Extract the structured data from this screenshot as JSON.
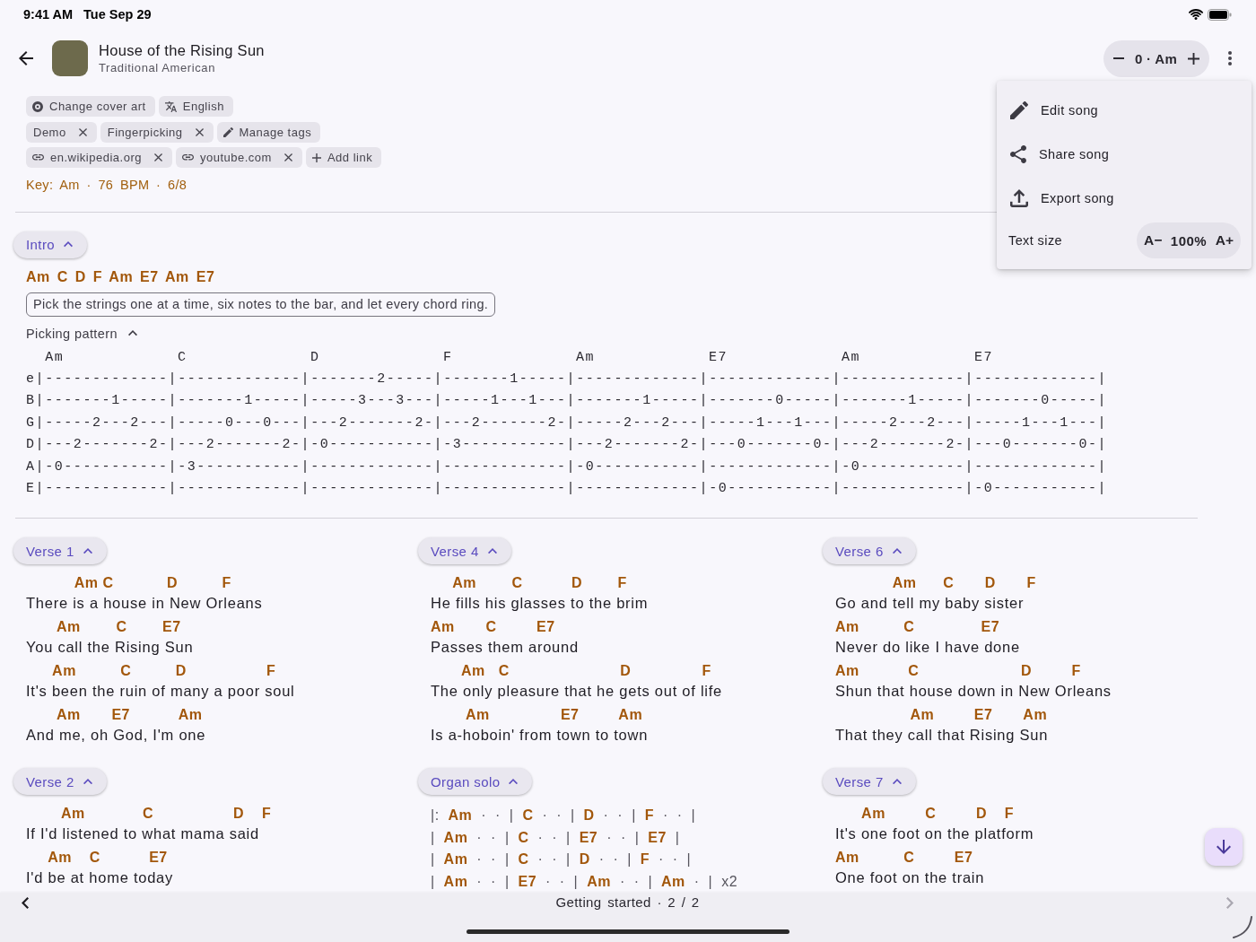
{
  "status": {
    "time": "9:41 AM",
    "date": "Tue Sep 29"
  },
  "song": {
    "title": "House of the Rising Sun",
    "artist": "Traditional American"
  },
  "transpose": {
    "value": "0 · Am"
  },
  "chip_rows": [
    [
      {
        "kind": "cover",
        "label": "Change cover art"
      },
      {
        "kind": "language",
        "label": "English"
      }
    ],
    [
      {
        "kind": "tag",
        "label": "Demo"
      },
      {
        "kind": "tag",
        "label": "Fingerpicking"
      },
      {
        "kind": "manage",
        "label": "Manage tags"
      }
    ],
    [
      {
        "kind": "link",
        "label": "en.wikipedia.org"
      },
      {
        "kind": "link",
        "label": "youtube.com"
      },
      {
        "kind": "add",
        "label": "Add link"
      }
    ]
  ],
  "meta": "Key: Am · 76 BPM · 6/8",
  "intro": {
    "name": "Intro",
    "expanded": true,
    "chords": "Am C D F Am E7 Am E7",
    "note": "Pick the strings one at a time, six notes to the bar, and let every chord ring.",
    "pattern": {
      "label": "Picking pattern",
      "expanded": true,
      "chords": [
        "Am",
        "C",
        "D",
        "F",
        "Am",
        "E7",
        "Am",
        "E7"
      ],
      "strings": [
        "e|-------------|-------------|-------2-----|-------1-----|-------------|-------------|-------------|-------------|",
        "B|-------1-----|-------1-----|-----3---3---|-----1---1---|-------1-----|-------0-----|-------1-----|-------0-----|",
        "G|-----2---2---|-----0---0---|---2-------2-|---2-------2-|-----2---2---|-----1---1---|-----2---2---|-----1---1---|",
        "D|---2-------2-|---2-------2-|-0-----------|-3-----------|---2-------2-|---0-------0-|---2-------2-|---0-------0-|",
        "A|-0-----------|-3-----------|-------------|-------------|-0-----------|-------------|-0-----------|-------------|",
        "E|-------------|-------------|-------------|-------------|-------------|-0-----------|-------------|-0-----------|"
      ]
    }
  },
  "section_columns": [
    [
      {
        "name": "Verse 1",
        "expanded": true,
        "kind": "lyrics",
        "lines": [
          {
            "chords": "           Am C            D          F",
            "lyric": "There is a house in New Orleans"
          },
          {
            "chords": "       Am        C        E7",
            "lyric": "You call the Rising Sun"
          },
          {
            "chords": "      Am          C          D                  F",
            "lyric": "It's been the ruin of many a poor soul"
          },
          {
            "chords": "       Am       E7           Am",
            "lyric": "And me, oh God, I'm one"
          }
        ]
      },
      {
        "name": "Verse 2",
        "expanded": true,
        "kind": "lyrics",
        "lines": [
          {
            "chords": "        Am             C                  D    F",
            "lyric": "If I'd listened to what mama said"
          },
          {
            "chords": "     Am    C           E7",
            "lyric": "I'd be at home today"
          }
        ]
      }
    ],
    [
      {
        "name": "Verse 4",
        "expanded": true,
        "kind": "lyrics",
        "lines": [
          {
            "chords": "     Am        C           D        F",
            "lyric": "He fills his glasses to the brim"
          },
          {
            "chords": "Am       C         E7",
            "lyric": "Passes them around"
          },
          {
            "chords": "       Am   C                         D                F",
            "lyric": "The only pleasure that he gets out of life"
          },
          {
            "chords": "        Am                E7         Am",
            "lyric": "Is a-hoboin' from town to town"
          }
        ]
      },
      {
        "name": "Organ solo",
        "expanded": true,
        "kind": "bars",
        "lines": [
          "|: **Am** · · | **C** · · | **D** · · | **F** · · |",
          "| **Am** · · | **C** · · | **E7** · · | **E7** |",
          "| **Am** · · | **C** · · | **D** · · | **F** · · |",
          "| **Am** · · | **E7** · · | **Am** · · | **Am** · | x2"
        ]
      }
    ],
    [
      {
        "name": "Verse 6",
        "expanded": true,
        "kind": "lyrics",
        "lines": [
          {
            "chords": "             Am      C       D       F",
            "lyric": "Go and tell my baby sister"
          },
          {
            "chords": "Am          C               E7",
            "lyric": "Never do like I have done"
          },
          {
            "chords": "Am           C                       D         F",
            "lyric": "Shun that house down in New Orleans"
          },
          {
            "chords": "                 Am         E7       Am",
            "lyric": "That they call that Rising Sun"
          }
        ]
      },
      {
        "name": "Verse 7",
        "expanded": true,
        "kind": "lyrics",
        "lines": [
          {
            "chords": "      Am         C         D    F",
            "lyric": "It's one foot on the platform"
          },
          {
            "chords": "Am          C         E7",
            "lyric": "One foot on the train"
          }
        ]
      }
    ]
  ],
  "menu": {
    "items": [
      {
        "kind": "edit",
        "label": "Edit song"
      },
      {
        "kind": "share",
        "label": "Share song"
      },
      {
        "kind": "export",
        "label": "Export song"
      }
    ],
    "text_size": {
      "label": "Text size",
      "decrease": "A−",
      "value": "100%",
      "increase": "A+"
    }
  },
  "pager": {
    "label": "Getting started · 2 / 2",
    "previous_disabled": false,
    "next_disabled": true
  }
}
